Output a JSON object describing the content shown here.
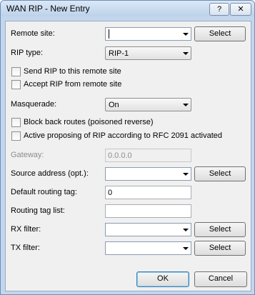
{
  "window": {
    "title": "WAN RIP - New Entry",
    "help_label": "?",
    "close_label": "✕"
  },
  "form": {
    "remote_site": {
      "label": "Remote site:",
      "value": "",
      "select_label": "Select"
    },
    "rip_type": {
      "label": "RIP type:",
      "value": "RIP-1"
    },
    "send_rip": {
      "label": "Send RIP to this remote site",
      "checked": false
    },
    "accept_rip": {
      "label": "Accept RIP from remote site",
      "checked": false
    },
    "masquerade": {
      "label": "Masquerade:",
      "value": "On"
    },
    "block_back_routes": {
      "label": "Block back routes (poisoned reverse)",
      "checked": false
    },
    "active_proposing": {
      "label": "Active proposing of RIP according to RFC 2091 activated",
      "checked": false
    },
    "gateway": {
      "label": "Gateway:",
      "value": "0.0.0.0",
      "disabled": true
    },
    "source_address": {
      "label": "Source address (opt.):",
      "value": "",
      "select_label": "Select"
    },
    "default_routing_tag": {
      "label": "Default routing tag:",
      "value": "0"
    },
    "routing_tag_list": {
      "label": "Routing tag list:",
      "value": ""
    },
    "rx_filter": {
      "label": "RX filter:",
      "value": "",
      "select_label": "Select"
    },
    "tx_filter": {
      "label": "TX filter:",
      "value": "",
      "select_label": "Select"
    }
  },
  "buttons": {
    "ok": "OK",
    "cancel": "Cancel"
  }
}
